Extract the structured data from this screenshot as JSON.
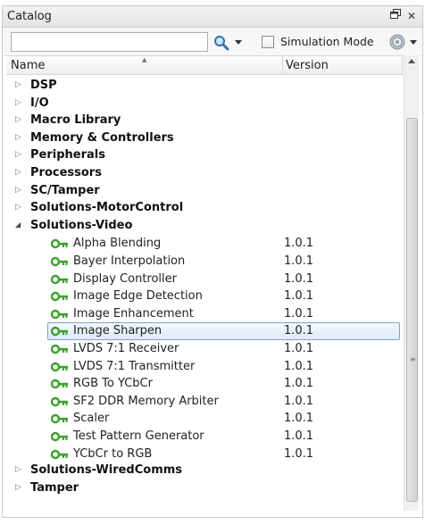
{
  "panel": {
    "title": "Catalog"
  },
  "toolbar": {
    "search_value": "",
    "simulation_mode_label": "Simulation Mode",
    "simulation_mode_checked": false
  },
  "columns": {
    "name": "Name",
    "version": "Version"
  },
  "categories_top": [
    {
      "label": "DSP",
      "expanded": false
    },
    {
      "label": "I/O",
      "expanded": false
    },
    {
      "label": "Macro Library",
      "expanded": false
    },
    {
      "label": "Memory & Controllers",
      "expanded": false
    },
    {
      "label": "Peripherals",
      "expanded": false
    },
    {
      "label": "Processors",
      "expanded": false
    },
    {
      "label": "SC/Tamper",
      "expanded": false
    },
    {
      "label": "Solutions-MotorControl",
      "expanded": false
    },
    {
      "label": "Solutions-Video",
      "expanded": true
    }
  ],
  "video_items": [
    {
      "name": "Alpha Blending",
      "version": "1.0.1"
    },
    {
      "name": "Bayer Interpolation",
      "version": "1.0.1"
    },
    {
      "name": "Display Controller",
      "version": "1.0.1"
    },
    {
      "name": "Image Edge Detection",
      "version": "1.0.1"
    },
    {
      "name": "Image Enhancement",
      "version": "1.0.1"
    },
    {
      "name": "Image Sharpen",
      "version": "1.0.1",
      "selected": true
    },
    {
      "name": "LVDS 7:1 Receiver",
      "version": "1.0.1"
    },
    {
      "name": "LVDS 7:1 Transmitter",
      "version": "1.0.1"
    },
    {
      "name": "RGB To YCbCr",
      "version": "1.0.1"
    },
    {
      "name": "SF2 DDR Memory Arbiter",
      "version": "1.0.1"
    },
    {
      "name": "Scaler",
      "version": "1.0.1"
    },
    {
      "name": "Test Pattern Generator",
      "version": "1.0.1"
    },
    {
      "name": "YCbCr to RGB",
      "version": "1.0.1"
    }
  ],
  "categories_bottom": [
    {
      "label": "Solutions-WiredComms",
      "expanded": false
    },
    {
      "label": "Tamper",
      "expanded": false
    }
  ],
  "colors": {
    "ip_icon": "#3aa12c",
    "selection_border": "#7da2ce"
  }
}
